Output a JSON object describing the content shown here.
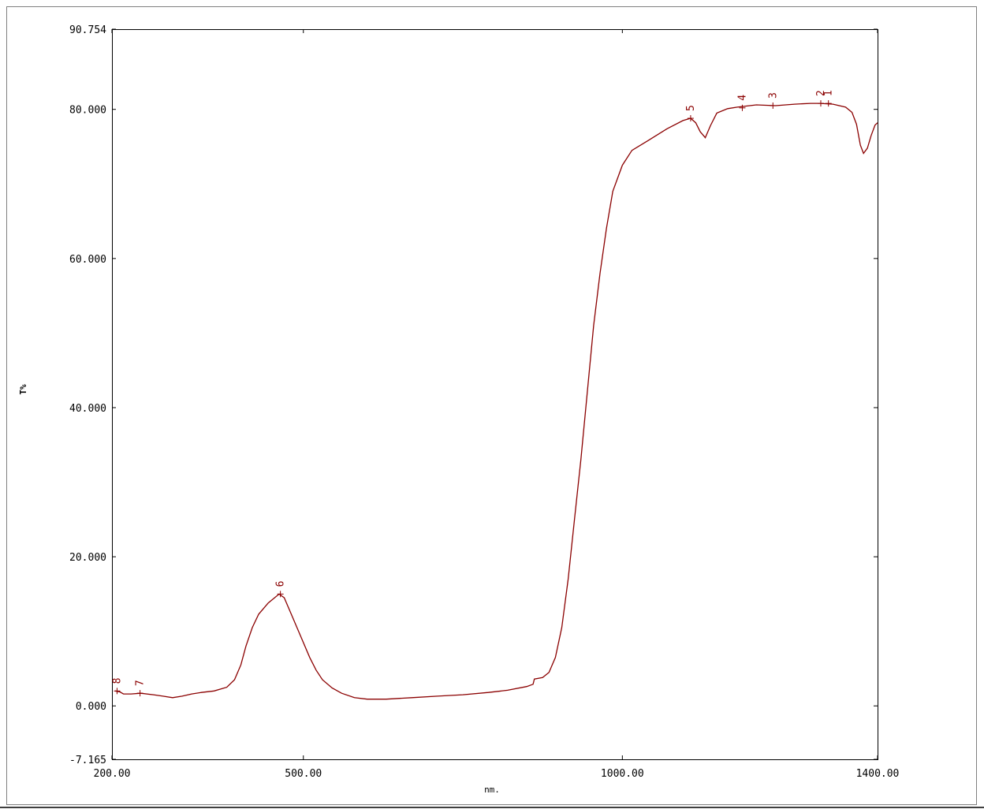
{
  "chart_data": {
    "type": "line",
    "title": "",
    "xlabel": "nm.",
    "ylabel": "T%",
    "xlim": [
      200,
      1400
    ],
    "ylim": [
      -7.165,
      90.754
    ],
    "x_ticks": [
      200,
      500,
      1000,
      1400
    ],
    "x_tick_labels": [
      "200.00",
      "500.00",
      "1000.00",
      "1400.00"
    ],
    "y_ticks": [
      -7.165,
      0,
      20,
      40,
      60,
      80,
      90.754
    ],
    "y_tick_labels": [
      "-7.165",
      "0.000",
      "20.000",
      "40.000",
      "60.000",
      "80.000",
      "90.754"
    ],
    "grid": false,
    "colors": {
      "line": "#8b0000",
      "axis": "#000000",
      "frame": "#808080"
    },
    "series": [
      {
        "points": [
          [
            205,
            2.0
          ],
          [
            212,
            1.9
          ],
          [
            218,
            1.6
          ],
          [
            230,
            1.6
          ],
          [
            245,
            1.7
          ],
          [
            265,
            1.5
          ],
          [
            280,
            1.3
          ],
          [
            295,
            1.1
          ],
          [
            310,
            1.3
          ],
          [
            325,
            1.6
          ],
          [
            340,
            1.8
          ],
          [
            360,
            2.0
          ],
          [
            380,
            2.5
          ],
          [
            392,
            3.5
          ],
          [
            402,
            5.5
          ],
          [
            410,
            8.0
          ],
          [
            420,
            10.5
          ],
          [
            430,
            12.3
          ],
          [
            445,
            13.8
          ],
          [
            462,
            15.0
          ],
          [
            470,
            14.5
          ],
          [
            480,
            12.5
          ],
          [
            495,
            9.5
          ],
          [
            510,
            6.5
          ],
          [
            520,
            4.8
          ],
          [
            530,
            3.5
          ],
          [
            545,
            2.4
          ],
          [
            560,
            1.7
          ],
          [
            580,
            1.1
          ],
          [
            600,
            0.9
          ],
          [
            630,
            0.9
          ],
          [
            670,
            1.1
          ],
          [
            710,
            1.3
          ],
          [
            750,
            1.5
          ],
          [
            790,
            1.8
          ],
          [
            820,
            2.1
          ],
          [
            850,
            2.6
          ],
          [
            860,
            2.9
          ],
          [
            862,
            3.6
          ],
          [
            875,
            3.8
          ],
          [
            885,
            4.5
          ],
          [
            895,
            6.5
          ],
          [
            905,
            10.5
          ],
          [
            915,
            17.0
          ],
          [
            925,
            25.0
          ],
          [
            935,
            33.0
          ],
          [
            945,
            42.0
          ],
          [
            955,
            51.0
          ],
          [
            965,
            58.0
          ],
          [
            975,
            64.0
          ],
          [
            985,
            69.0
          ],
          [
            1000,
            72.5
          ],
          [
            1015,
            74.5
          ],
          [
            1040,
            75.8
          ],
          [
            1070,
            77.4
          ],
          [
            1095,
            78.5
          ],
          [
            1107,
            78.8
          ],
          [
            1115,
            78.2
          ],
          [
            1122,
            77.0
          ],
          [
            1130,
            76.2
          ],
          [
            1138,
            77.8
          ],
          [
            1148,
            79.5
          ],
          [
            1165,
            80.1
          ],
          [
            1180,
            80.3
          ],
          [
            1210,
            80.6
          ],
          [
            1240,
            80.5
          ],
          [
            1270,
            80.7
          ],
          [
            1295,
            80.8
          ],
          [
            1310,
            80.8
          ],
          [
            1330,
            80.7
          ],
          [
            1350,
            80.3
          ],
          [
            1360,
            79.6
          ],
          [
            1367,
            78.0
          ],
          [
            1373,
            75.2
          ],
          [
            1378,
            74.1
          ],
          [
            1384,
            74.8
          ],
          [
            1390,
            76.5
          ],
          [
            1396,
            77.9
          ],
          [
            1400,
            78.2
          ]
        ]
      }
    ],
    "peaks": [
      {
        "label": "1",
        "x": 1323,
        "y": 80.8
      },
      {
        "label": "2",
        "x": 1311,
        "y": 80.8
      },
      {
        "label": "3",
        "x": 1236,
        "y": 80.5
      },
      {
        "label": "4",
        "x": 1188,
        "y": 80.2
      },
      {
        "label": "5",
        "x": 1107,
        "y": 78.8
      },
      {
        "label": "6",
        "x": 464,
        "y": 15.0
      },
      {
        "label": "7",
        "x": 244,
        "y": 1.7
      },
      {
        "label": "8",
        "x": 208,
        "y": 2.0
      }
    ]
  }
}
